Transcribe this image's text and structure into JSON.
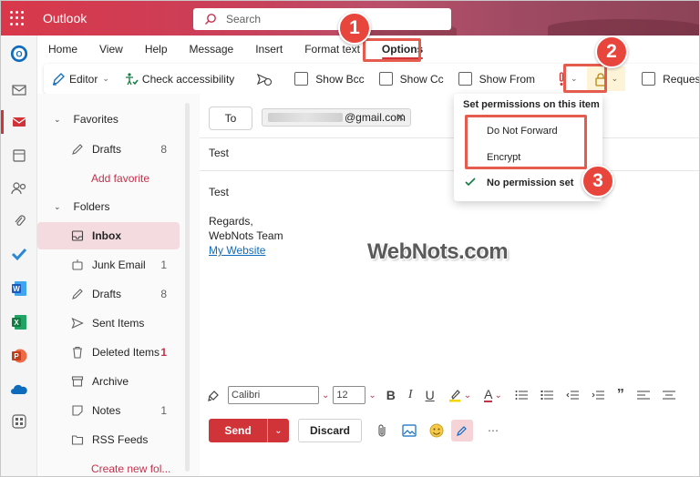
{
  "app": {
    "title": "Outlook"
  },
  "search": {
    "placeholder": "Search"
  },
  "ribbon": {
    "tabs": [
      "Home",
      "View",
      "Help",
      "Message",
      "Insert",
      "Format text",
      "Options"
    ],
    "active_tab": "Options"
  },
  "toolbar": {
    "editor": "Editor",
    "check_accessibility": "Check accessibility",
    "show_bcc": "Show Bcc",
    "show_cc": "Show Cc",
    "show_from": "Show From",
    "request_delivery": "Request deliv"
  },
  "folders": {
    "favorites_header": "Favorites",
    "favorites": [
      {
        "label": "Drafts",
        "count": "8"
      }
    ],
    "add_favorite": "Add favorite",
    "folders_header": "Folders",
    "items": [
      {
        "label": "Inbox",
        "count": ""
      },
      {
        "label": "Junk Email",
        "count": "1"
      },
      {
        "label": "Drafts",
        "count": "8"
      },
      {
        "label": "Sent Items",
        "count": ""
      },
      {
        "label": "Deleted Items",
        "count": "1"
      },
      {
        "label": "Archive",
        "count": ""
      },
      {
        "label": "Notes",
        "count": "1"
      },
      {
        "label": "RSS Feeds",
        "count": ""
      }
    ],
    "create_new": "Create new fol..."
  },
  "compose": {
    "to_label": "To",
    "recipient_visible": "@gmail.com",
    "subject": "Test",
    "body_lines": [
      "Test",
      "",
      "Regards,",
      "WebNots Team"
    ],
    "link": "My Website",
    "font": "Calibri",
    "font_size": "12",
    "send": "Send",
    "discard": "Discard"
  },
  "permissions_menu": {
    "header": "Set permissions on this item",
    "items": [
      "Do Not Forward",
      "Encrypt",
      "No permission set"
    ],
    "checked": "No permission set"
  },
  "annotations": {
    "badges": [
      "1",
      "2",
      "3"
    ],
    "watermark": "WebNots.com"
  },
  "colors": {
    "accent": "#d13438",
    "annotation": "#e8453c",
    "link": "#0f6cbd"
  }
}
